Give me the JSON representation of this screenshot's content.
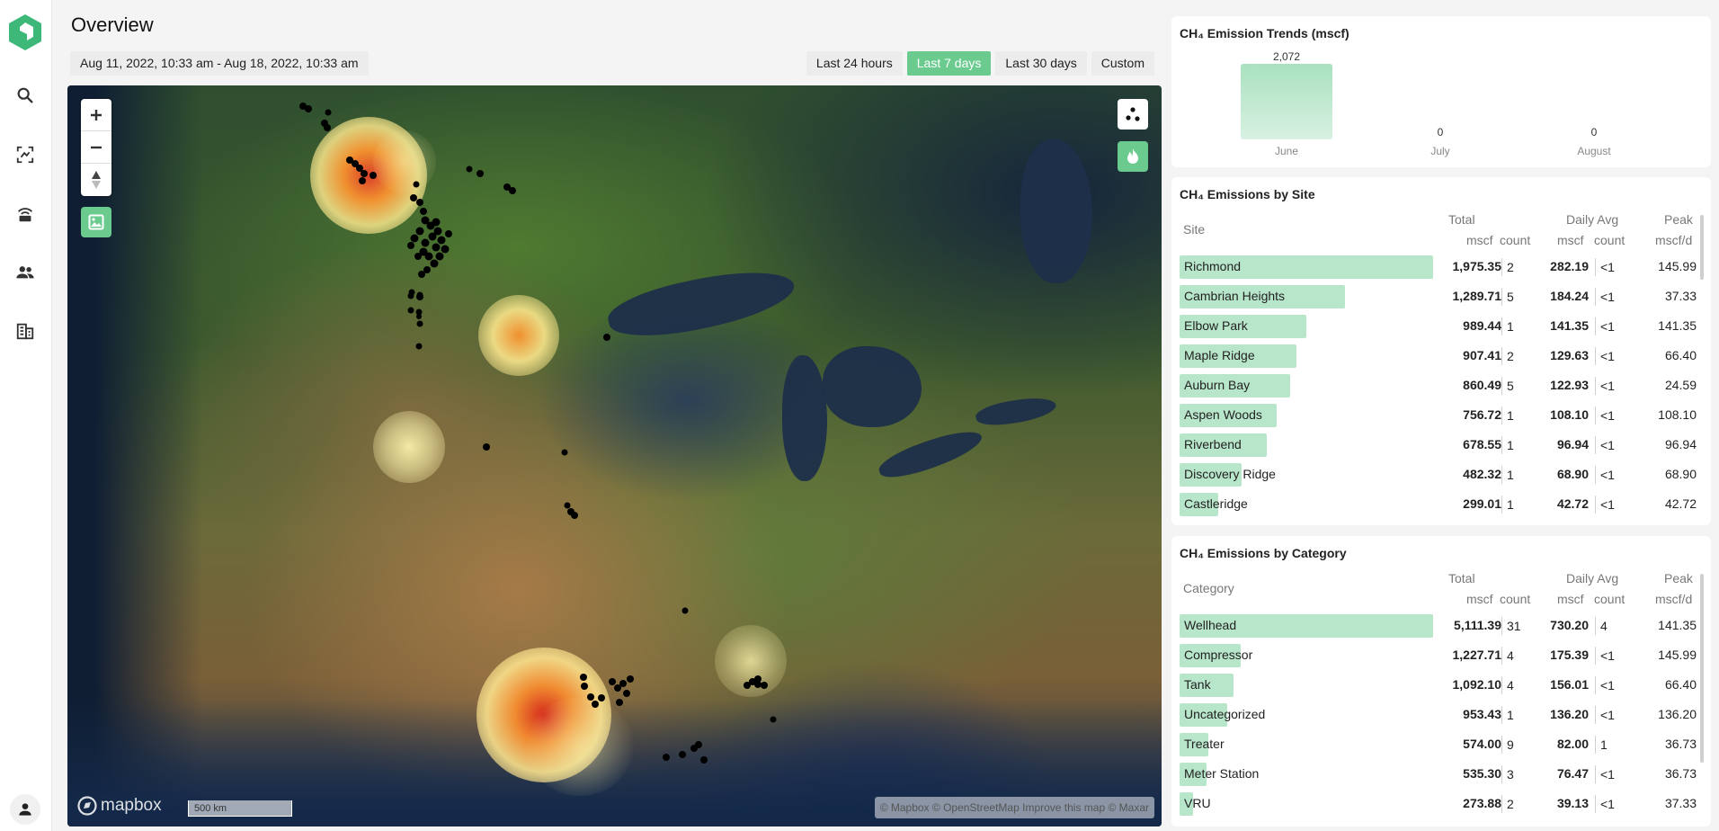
{
  "page": {
    "title": "Overview",
    "date_range": "Aug 11, 2022, 10:33 am - Aug 18, 2022, 10:33 am",
    "range_buttons": [
      {
        "label": "Last 24 hours",
        "active": false
      },
      {
        "label": "Last 7 days",
        "active": true
      },
      {
        "label": "Last 30 days",
        "active": false
      },
      {
        "label": "Custom",
        "active": false
      }
    ]
  },
  "sidebar": {
    "icons": [
      "search-icon",
      "scan-icon",
      "sensor-icon",
      "users-icon",
      "buildings-icon"
    ],
    "profile_icon": "user-icon"
  },
  "map": {
    "logo_text": "mapbox",
    "scale_text": "500 km",
    "attribution": "© Mapbox © OpenStreetMap  Improve this map © Maxar"
  },
  "colors": {
    "accent": "#6bcb8f",
    "bar": "#b8e6ca",
    "logo": "#3db878"
  },
  "trend": {
    "title": "CH₄ Emission Trends (mscf)",
    "chart_data": {
      "type": "bar",
      "categories": [
        "June",
        "July",
        "August"
      ],
      "values": [
        2072,
        0,
        0
      ],
      "value_labels": [
        "2,072",
        "0",
        "0"
      ]
    }
  },
  "by_site": {
    "title": "CH₄ Emissions by Site",
    "headers": {
      "name": "Site",
      "total": "Total",
      "daily_avg": "Daily Avg",
      "peak": "Peak",
      "mscf": "mscf",
      "count": "count",
      "mscf_d": "mscf/d"
    },
    "rows": [
      {
        "name": "Richmond",
        "total": "1,975.35",
        "count": "2",
        "avg": "282.19",
        "avg_count": "<1",
        "peak": "145.99",
        "value": 1975.35
      },
      {
        "name": "Cambrian Heights",
        "total": "1,289.71",
        "count": "5",
        "avg": "184.24",
        "avg_count": "<1",
        "peak": "37.33",
        "value": 1289.71
      },
      {
        "name": "Elbow Park",
        "total": "989.44",
        "count": "1",
        "avg": "141.35",
        "avg_count": "<1",
        "peak": "141.35",
        "value": 989.44
      },
      {
        "name": "Maple Ridge",
        "total": "907.41",
        "count": "2",
        "avg": "129.63",
        "avg_count": "<1",
        "peak": "66.40",
        "value": 907.41
      },
      {
        "name": "Auburn Bay",
        "total": "860.49",
        "count": "5",
        "avg": "122.93",
        "avg_count": "<1",
        "peak": "24.59",
        "value": 860.49
      },
      {
        "name": "Aspen Woods",
        "total": "756.72",
        "count": "1",
        "avg": "108.10",
        "avg_count": "<1",
        "peak": "108.10",
        "value": 756.72
      },
      {
        "name": "Riverbend",
        "total": "678.55",
        "count": "1",
        "avg": "96.94",
        "avg_count": "<1",
        "peak": "96.94",
        "value": 678.55
      },
      {
        "name": "Discovery Ridge",
        "total": "482.32",
        "count": "1",
        "avg": "68.90",
        "avg_count": "<1",
        "peak": "68.90",
        "value": 482.32
      },
      {
        "name": "Castleridge",
        "total": "299.01",
        "count": "1",
        "avg": "42.72",
        "avg_count": "<1",
        "peak": "42.72",
        "value": 299.01
      }
    ]
  },
  "by_category": {
    "title": "CH₄ Emissions by Category",
    "headers": {
      "name": "Category",
      "total": "Total",
      "daily_avg": "Daily Avg",
      "peak": "Peak",
      "mscf": "mscf",
      "count": "count",
      "mscf_d": "mscf/d"
    },
    "rows": [
      {
        "name": "Wellhead",
        "total": "5,111.39",
        "count": "31",
        "avg": "730.20",
        "avg_count": "4",
        "peak": "141.35",
        "value": 5111.39
      },
      {
        "name": "Compressor",
        "total": "1,227.71",
        "count": "4",
        "avg": "175.39",
        "avg_count": "<1",
        "peak": "145.99",
        "value": 1227.71
      },
      {
        "name": "Tank",
        "total": "1,092.10",
        "count": "4",
        "avg": "156.01",
        "avg_count": "<1",
        "peak": "66.40",
        "value": 1092.1
      },
      {
        "name": "Uncategorized",
        "total": "953.43",
        "count": "1",
        "avg": "136.20",
        "avg_count": "<1",
        "peak": "136.20",
        "value": 953.43
      },
      {
        "name": "Treater",
        "total": "574.00",
        "count": "9",
        "avg": "82.00",
        "avg_count": "1",
        "peak": "36.73",
        "value": 574.0
      },
      {
        "name": "Meter Station",
        "total": "535.30",
        "count": "3",
        "avg": "76.47",
        "avg_count": "<1",
        "peak": "36.73",
        "value": 535.3
      },
      {
        "name": "VRU",
        "total": "273.88",
        "count": "2",
        "avg": "39.13",
        "avg_count": "<1",
        "peak": "37.33",
        "value": 273.88
      }
    ]
  }
}
